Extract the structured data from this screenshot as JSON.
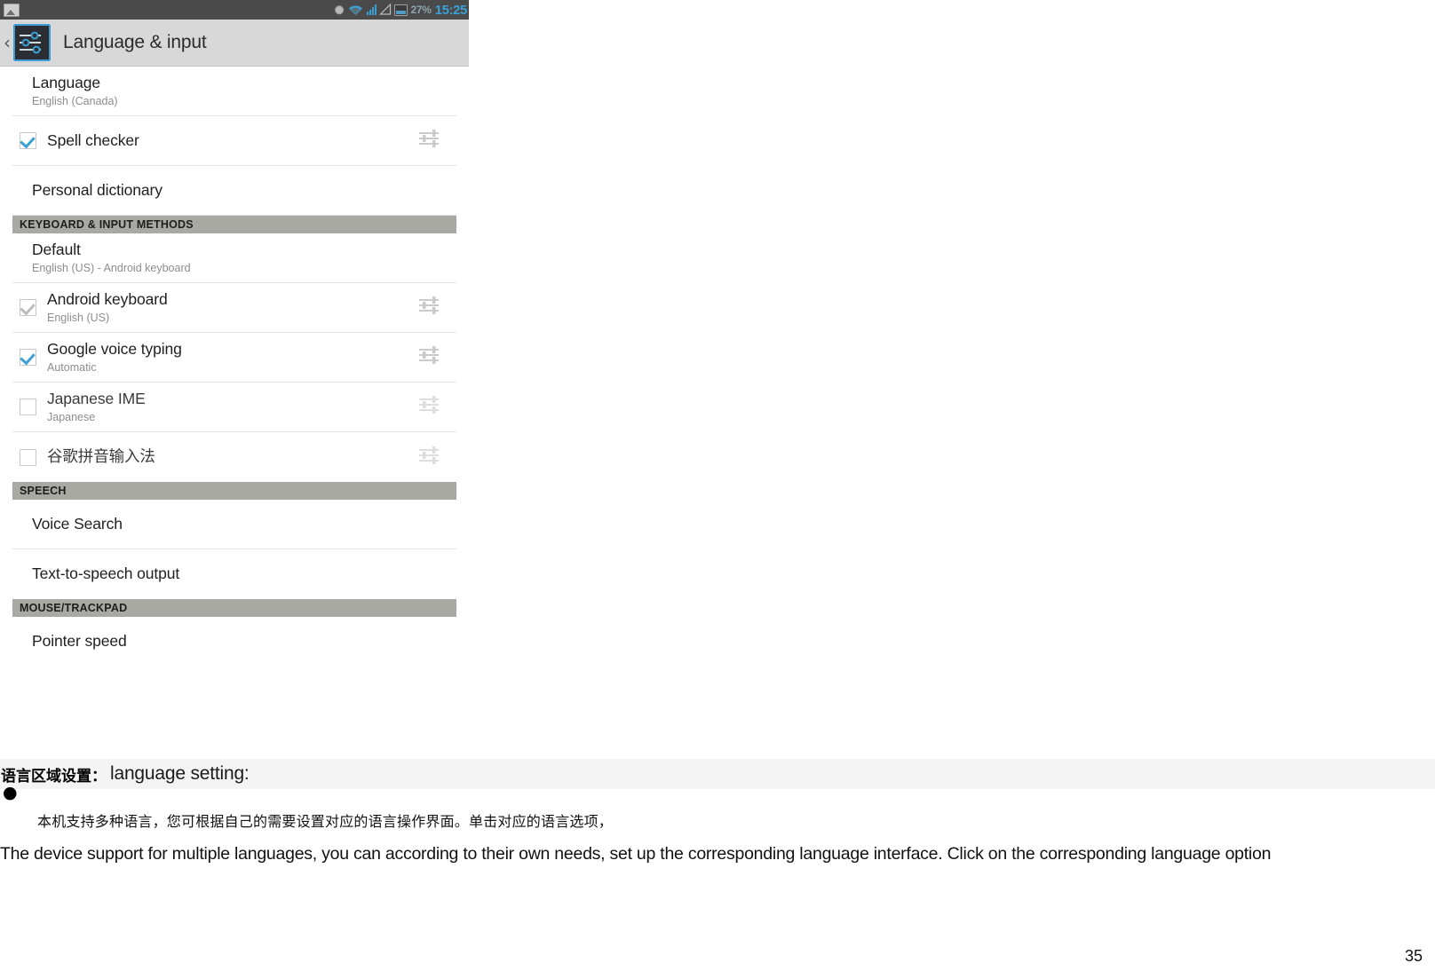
{
  "screenshot": {
    "statusbar": {
      "photo_icon": "photo-icon",
      "bluetooth_icon": "bluetooth-icon",
      "wifi_icon": "wifi-icon",
      "signal_icon": "cellular-signal-icon",
      "alarm_icon": "triangle-warning-icon",
      "battery_icon": "battery-icon",
      "battery_percent": "27%",
      "time": "15:25"
    },
    "actionbar": {
      "back_icon": "back-chevron-icon",
      "app_icon": "settings-sliders-icon",
      "title": "Language & input"
    },
    "rows": [
      {
        "id": "language",
        "primary": "Language",
        "secondary": "English (Canada)",
        "checkbox": "none",
        "tuner": false
      },
      {
        "id": "spell-checker",
        "primary": "Spell checker",
        "secondary": "",
        "checkbox": "checked",
        "tuner": true
      },
      {
        "id": "personal-dictionary",
        "primary": "Personal dictionary",
        "secondary": "",
        "checkbox": "none",
        "tuner": false
      }
    ],
    "section_keyboard": "KEYBOARD & INPUT METHODS",
    "keyboard_rows": [
      {
        "id": "default",
        "primary": "Default",
        "secondary": "English (US) - Android keyboard",
        "checkbox": "none",
        "tuner": false
      },
      {
        "id": "android-keyboard",
        "primary": "Android keyboard",
        "secondary": "English (US)",
        "checkbox": "checked-dim",
        "tuner": true
      },
      {
        "id": "google-voice-typing",
        "primary": "Google voice typing",
        "secondary": "Automatic",
        "checkbox": "checked",
        "tuner": true
      },
      {
        "id": "japanese-ime",
        "primary": "Japanese IME",
        "secondary": "Japanese",
        "checkbox": "unchecked",
        "tuner": true
      },
      {
        "id": "google-pinyin-ime",
        "primary": "谷歌拼音输入法",
        "secondary": "",
        "checkbox": "unchecked",
        "tuner": true
      }
    ],
    "section_speech": "SPEECH",
    "speech_rows": [
      {
        "id": "voice-search",
        "primary": "Voice Search",
        "secondary": "",
        "checkbox": "none",
        "tuner": false
      },
      {
        "id": "text-to-speech-output",
        "primary": "Text-to-speech output",
        "secondary": "",
        "checkbox": "none",
        "tuner": false
      }
    ],
    "section_mouse": "MOUSE/TRACKPAD",
    "mouse_rows": [
      {
        "id": "pointer-speed",
        "primary": "Pointer speed",
        "secondary": "",
        "checkbox": "none",
        "tuner": false
      }
    ]
  },
  "document": {
    "heading_cn": "语言区域设置：",
    "heading_en": "language setting:",
    "bullet": "●",
    "body_cn": "本机支持多种语言，您可根据自己的需要设置对应的语言操作界面。单击对应的语言选项，",
    "body_en": "The device support for multiple languages, you can according to their own needs, set up the corresponding language interface. Click on the corresponding language option",
    "page_number": "35"
  },
  "colors": {
    "accent_blue": "#3ba0d6",
    "status_bar": "#4a4a4a",
    "action_bar": "#d8d8d8",
    "section_band": "#a9a9a3",
    "heading_band": "#f4f4f4"
  }
}
